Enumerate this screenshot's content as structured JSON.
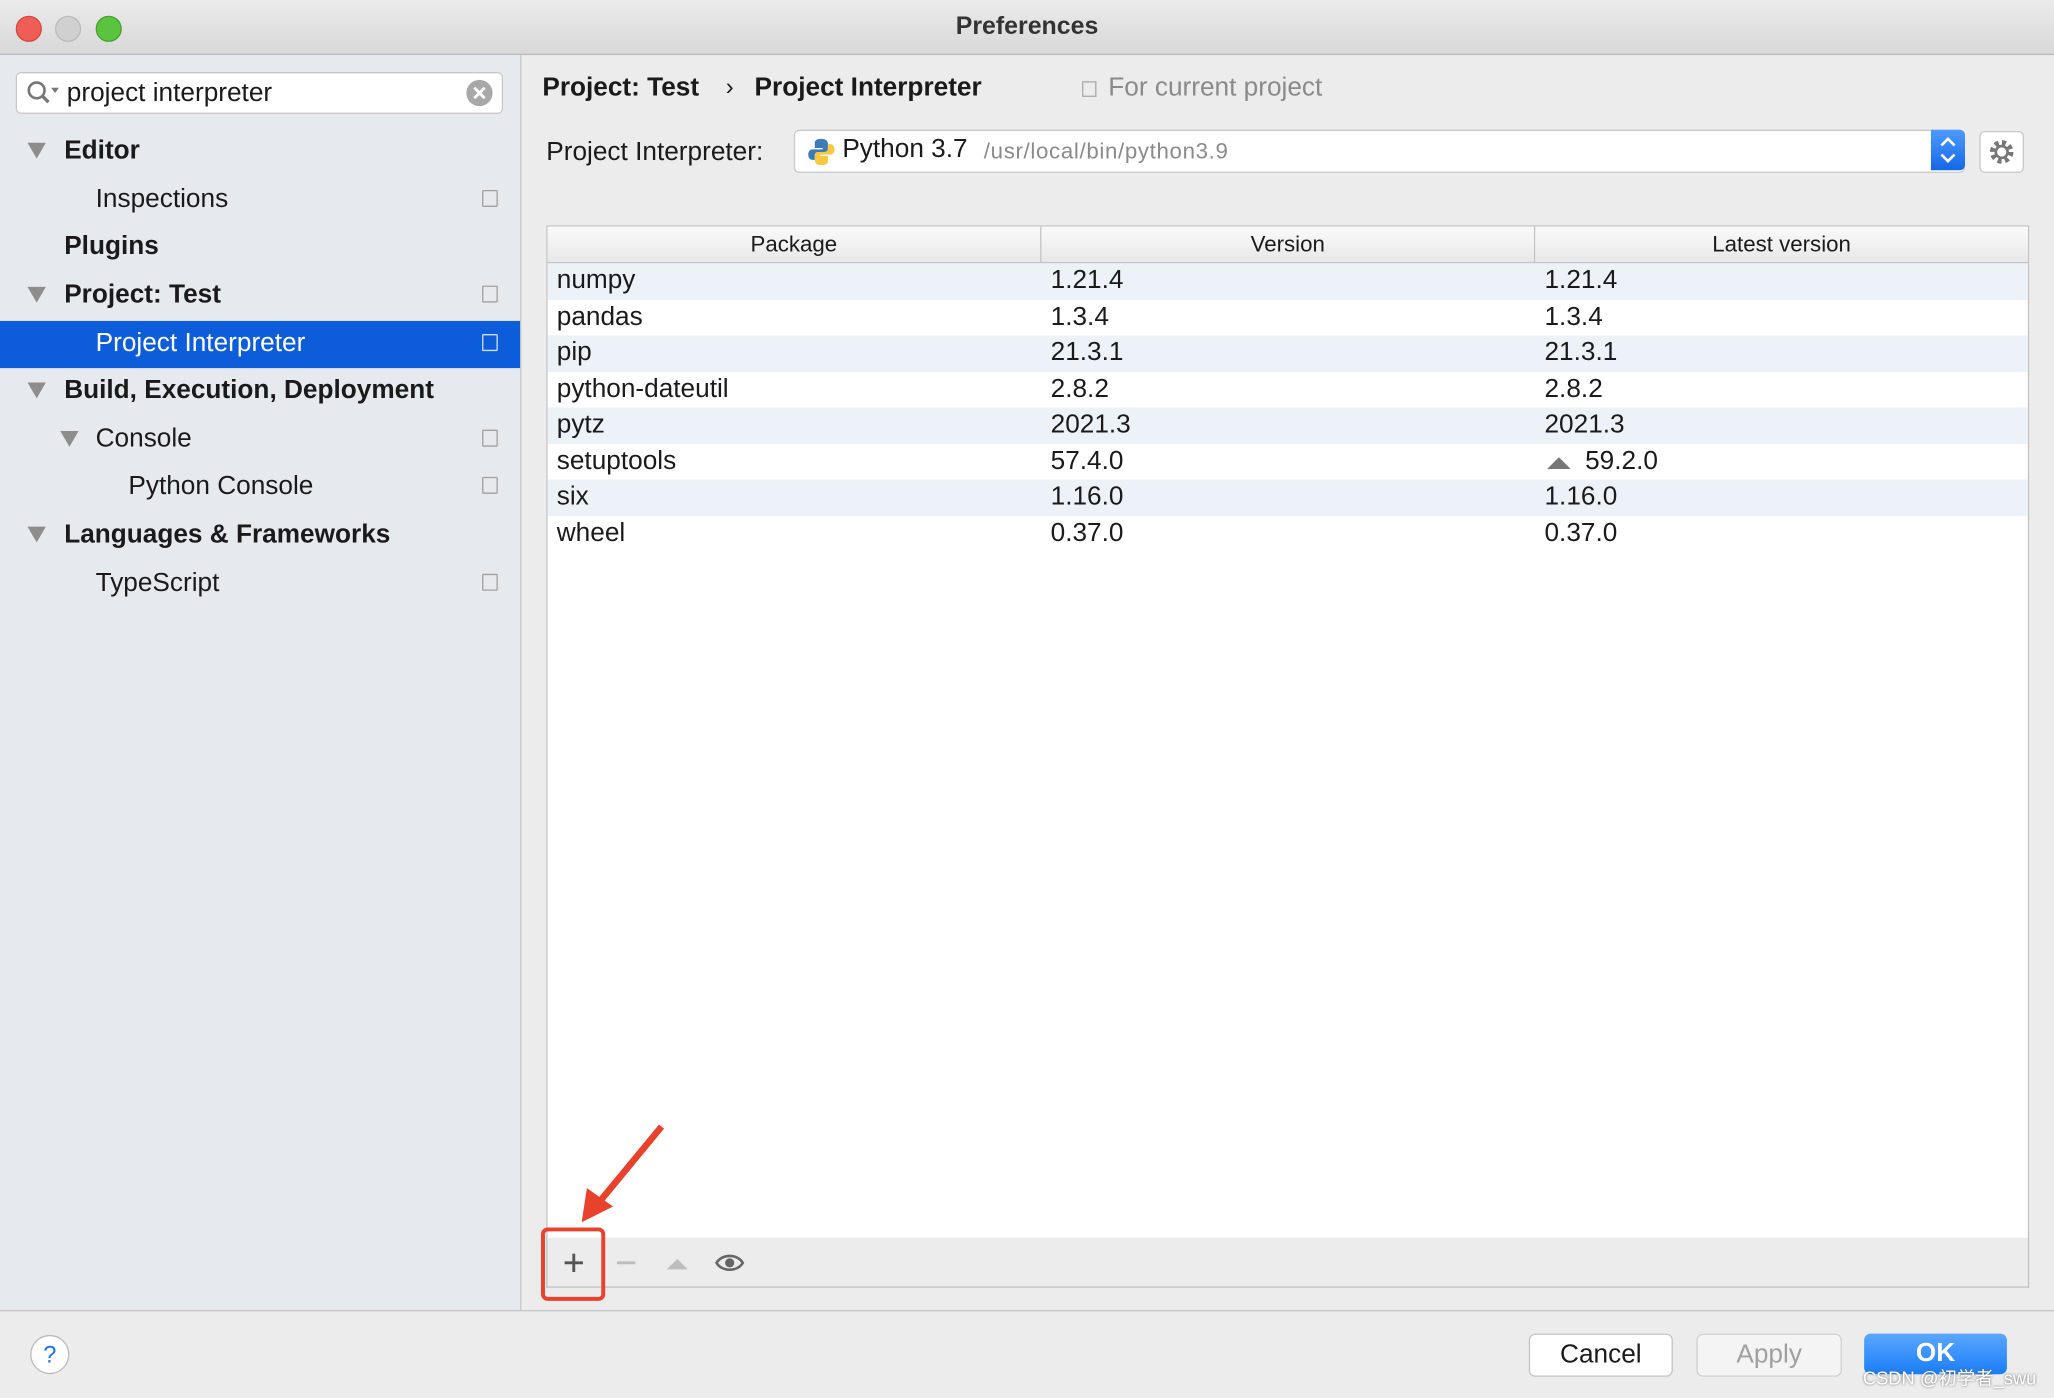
{
  "window": {
    "title": "Preferences"
  },
  "sidebar": {
    "search": {
      "value": "project interpreter"
    },
    "items": [
      {
        "label": "Editor"
      },
      {
        "label": "Inspections"
      },
      {
        "label": "Plugins"
      },
      {
        "label": "Project: Test"
      },
      {
        "label": "Project Interpreter"
      },
      {
        "label": "Build, Execution, Deployment"
      },
      {
        "label": "Console"
      },
      {
        "label": "Python Console"
      },
      {
        "label": "Languages & Frameworks"
      },
      {
        "label": "TypeScript"
      }
    ]
  },
  "main": {
    "breadcrumb": {
      "parent": "Project: Test",
      "separator": "›",
      "current": "Project Interpreter",
      "scope": "For current project"
    },
    "interpreter": {
      "label": "Project Interpreter:",
      "name": "Python 3.7",
      "path": "/usr/local/bin/python3.9"
    },
    "table": {
      "columns": [
        "Package",
        "Version",
        "Latest version"
      ],
      "rows": [
        {
          "package": "numpy",
          "version": "1.21.4",
          "latest": "1.21.4",
          "upgrade": false
        },
        {
          "package": "pandas",
          "version": "1.3.4",
          "latest": "1.3.4",
          "upgrade": false
        },
        {
          "package": "pip",
          "version": "21.3.1",
          "latest": "21.3.1",
          "upgrade": false
        },
        {
          "package": "python-dateutil",
          "version": "2.8.2",
          "latest": "2.8.2",
          "upgrade": false
        },
        {
          "package": "pytz",
          "version": "2021.3",
          "latest": "2021.3",
          "upgrade": false
        },
        {
          "package": "setuptools",
          "version": "57.4.0",
          "latest": "59.2.0",
          "upgrade": true
        },
        {
          "package": "six",
          "version": "1.16.0",
          "latest": "1.16.0",
          "upgrade": false
        },
        {
          "package": "wheel",
          "version": "0.37.0",
          "latest": "0.37.0",
          "upgrade": false
        }
      ]
    },
    "toolbar": {
      "icons": [
        "plus-icon",
        "minus-icon",
        "upgrade-triangle-icon",
        "eye-icon"
      ]
    }
  },
  "footer": {
    "help": "?",
    "cancel": "Cancel",
    "apply": "Apply",
    "ok": "OK"
  },
  "watermark": "CSDN @初学者_swu",
  "colors": {
    "selection": "#0d5ddb",
    "ok_button": "#1a7df7",
    "annotation": "#e8412c"
  }
}
